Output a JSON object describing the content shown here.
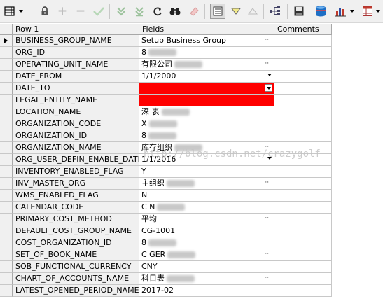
{
  "toolbar": {
    "buttons": [
      {
        "name": "grid-layout-icon"
      },
      {
        "name": "lock-icon"
      },
      {
        "name": "plus-icon"
      },
      {
        "name": "minus-icon"
      },
      {
        "name": "check-icon"
      },
      {
        "name": "double-down-arrow-icon"
      },
      {
        "name": "double-down-arrow-alt-icon"
      },
      {
        "name": "refresh-icon"
      },
      {
        "name": "binoculars-icon"
      },
      {
        "name": "eraser-icon"
      },
      {
        "name": "single-record-view-icon"
      },
      {
        "name": "filter-down-icon"
      },
      {
        "name": "filter-up-icon"
      },
      {
        "name": "tree-icon"
      },
      {
        "name": "save-icon"
      },
      {
        "name": "database-icon"
      },
      {
        "name": "chart-icon"
      },
      {
        "name": "table-icon"
      }
    ]
  },
  "grid": {
    "headers": {
      "row": "Row 1",
      "fields": "Fields",
      "comments": "Comments"
    },
    "rows": [
      {
        "field": "BUSINESS_GROUP_NAME",
        "value": "Setup Business Group",
        "ellipsis": true,
        "current": true
      },
      {
        "field": "ORG_ID",
        "value": "8",
        "blur": true
      },
      {
        "field": "OPERATING_UNIT_NAME",
        "value": "有限公司",
        "blur": true,
        "ellipsis": true
      },
      {
        "field": "DATE_FROM",
        "value": "1/1/2000",
        "dropdown": true
      },
      {
        "field": "DATE_TO",
        "value": "",
        "red": true,
        "dropdownBox": true
      },
      {
        "field": "LEGAL_ENTITY_NAME",
        "value": "",
        "red": true
      },
      {
        "field": "LOCATION_NAME",
        "value": "深 表",
        "blur": true
      },
      {
        "field": "ORGANIZATION_CODE",
        "value": "X",
        "blur": true
      },
      {
        "field": "ORGANIZATION_ID",
        "value": "8",
        "blur": true
      },
      {
        "field": "ORGANIZATION_NAME",
        "value": "库存组织",
        "blur": true,
        "ellipsis": true
      },
      {
        "field": "ORG_USER_DEFIN_ENABLE_DATE",
        "value": "1/1/2016",
        "dropdown": true
      },
      {
        "field": "INVENTORY_ENABLED_FLAG",
        "value": "Y"
      },
      {
        "field": "INV_MASTER_ORG",
        "value": "主组织",
        "blur": true,
        "ellipsis": true
      },
      {
        "field": "WMS_ENABLED_FLAG",
        "value": "N"
      },
      {
        "field": "CALENDAR_CODE",
        "value": "C N",
        "blur": true
      },
      {
        "field": "PRIMARY_COST_METHOD",
        "value": "平均",
        "ellipsis": true
      },
      {
        "field": "DEFAULT_COST_GROUP_NAME",
        "value": "CG-1001"
      },
      {
        "field": "COST_ORGANIZATION_ID",
        "value": "8",
        "blur": true
      },
      {
        "field": "SET_OF_BOOK_NAME",
        "value": "C GER",
        "blur": true,
        "ellipsis": true
      },
      {
        "field": "SOB_FUNCTIONAL_CURRENCY",
        "value": "CNY"
      },
      {
        "field": "CHART_OF_ACCOUNTS_NAME",
        "value": "科目表",
        "blur": true,
        "ellipsis": true
      },
      {
        "field": "LATEST_OPENED_PERIOD_NAME",
        "value": "2017-02"
      }
    ]
  },
  "watermark": "http://blog.csdn.net/crazygolf",
  "colors": {
    "required": "#ff0000",
    "header": "#f0f0f0",
    "grid_line": "#c8c8c8"
  }
}
